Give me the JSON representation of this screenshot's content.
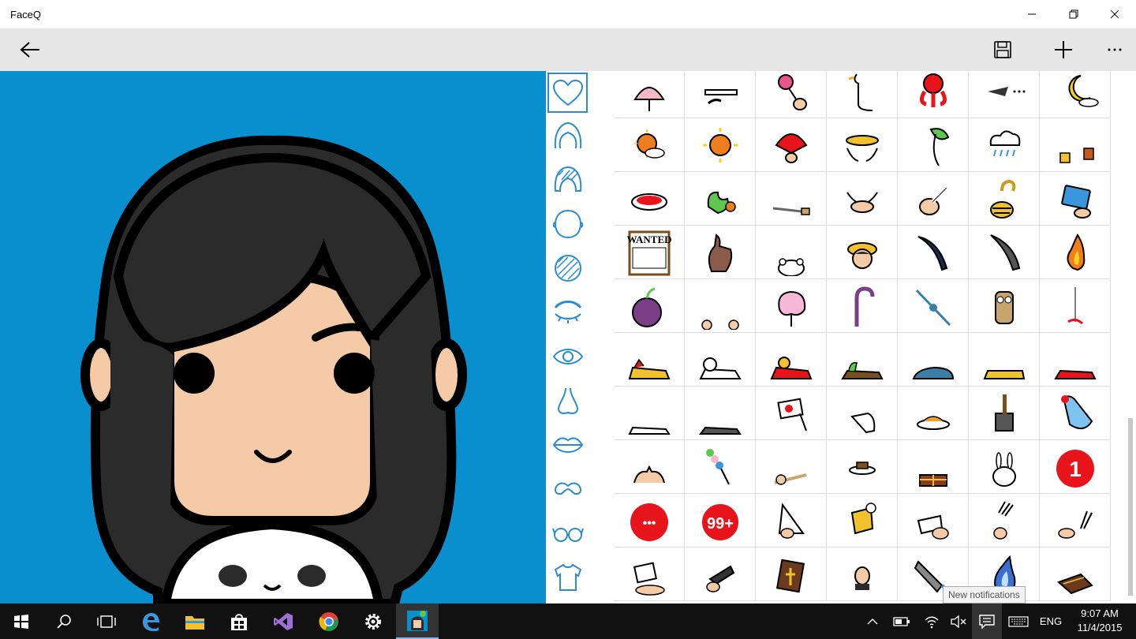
{
  "window": {
    "title": "FaceQ"
  },
  "appbar": {
    "icons": [
      "back-arrow-icon",
      "save-icon",
      "add-icon",
      "more-icon"
    ]
  },
  "rail": {
    "categories": [
      {
        "name": "heart",
        "selected": true
      },
      {
        "name": "hair-outline",
        "selected": false
      },
      {
        "name": "hair-filled",
        "selected": false
      },
      {
        "name": "face-shape",
        "selected": false
      },
      {
        "name": "face-texture",
        "selected": false
      },
      {
        "name": "eyebrows",
        "selected": false
      },
      {
        "name": "eyes",
        "selected": false
      },
      {
        "name": "nose",
        "selected": false
      },
      {
        "name": "mouth",
        "selected": false
      },
      {
        "name": "mustache",
        "selected": false
      },
      {
        "name": "glasses",
        "selected": false
      },
      {
        "name": "shirt",
        "selected": false
      }
    ]
  },
  "stickers": {
    "wanted_text": "WANTED",
    "badge_one": "1",
    "badge_dots": "•••",
    "badge_99": "99+"
  },
  "tooltip": {
    "text": "New notifications"
  },
  "taskbar": {
    "apps": [
      "start-icon",
      "search-icon",
      "task-view-icon",
      "edge-icon",
      "file-explorer-icon",
      "store-icon",
      "visual-studio-icon",
      "chrome-icon",
      "settings-icon",
      "faceq-app-icon"
    ],
    "language": "ENG",
    "time": "9:07 AM",
    "date": "11/4/2015"
  },
  "colors": {
    "canvas_bg": "#0a8fce",
    "appbar_bg": "#e6e6e6",
    "taskbar_bg": "#111111",
    "rail_accent": "#2a8bd0",
    "hair": "#2b2b2b",
    "skin": "#f5cba7",
    "badge_red": "#e8141c"
  }
}
